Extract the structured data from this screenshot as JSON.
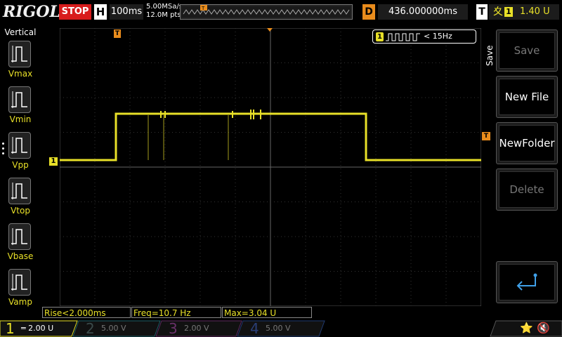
{
  "colors": {
    "ch1": "#e8e028",
    "ch2": "#2fb6c0",
    "ch3": "#c85ac8",
    "ch4": "#3f6fd8",
    "trigger": "#e98c1c",
    "stop": "#d81c1c"
  },
  "topbar": {
    "logo": "RIGOL",
    "run_state": "STOP",
    "horizontal_label": "H",
    "timebase": "100ms",
    "sample_rate": "5.00MSa/s",
    "memory_depth": "12.0M pts",
    "delay_label": "D",
    "delay_value": "436.000000ms",
    "trigger_label": "T",
    "trigger_source": "1",
    "trigger_level": "1.40 U"
  },
  "left_panel": {
    "title": "Vertical",
    "items": [
      {
        "label": "Vmax",
        "icon": "vmax-waveform-icon"
      },
      {
        "label": "Vmin",
        "icon": "vmin-waveform-icon"
      },
      {
        "label": "Vpp",
        "icon": "vpp-waveform-icon"
      },
      {
        "label": "Vtop",
        "icon": "vtop-waveform-icon"
      },
      {
        "label": "Vbase",
        "icon": "vbase-waveform-icon"
      },
      {
        "label": "Vamp",
        "icon": "vamp-waveform-icon"
      }
    ]
  },
  "freq_counter": {
    "channel": "1",
    "text": "< 15Hz"
  },
  "markers": {
    "ch1_ground": "1",
    "trigger_pos": "T"
  },
  "right_menu": {
    "tab": "Save",
    "buttons": [
      {
        "label": "Save",
        "enabled": false
      },
      {
        "label": "New File",
        "enabled": true
      },
      {
        "label": "NewFolder",
        "enabled": true
      },
      {
        "label": "Delete",
        "enabled": false
      }
    ],
    "back_icon": "return-arrow-icon"
  },
  "measurements": [
    {
      "text": "Rise<2.000ms"
    },
    {
      "text": "Freq=10.7 Hz"
    },
    {
      "text": "Max=3.04 U"
    }
  ],
  "channels": [
    {
      "num": "1",
      "scale": "2.00 U",
      "active": true
    },
    {
      "num": "2",
      "scale": "5.00 V",
      "active": false
    },
    {
      "num": "3",
      "scale": "2.00 V",
      "active": false
    },
    {
      "num": "4",
      "scale": "5.00 V",
      "active": false
    }
  ],
  "status_icons": [
    "usb-icon",
    "speaker-mute-icon"
  ]
}
